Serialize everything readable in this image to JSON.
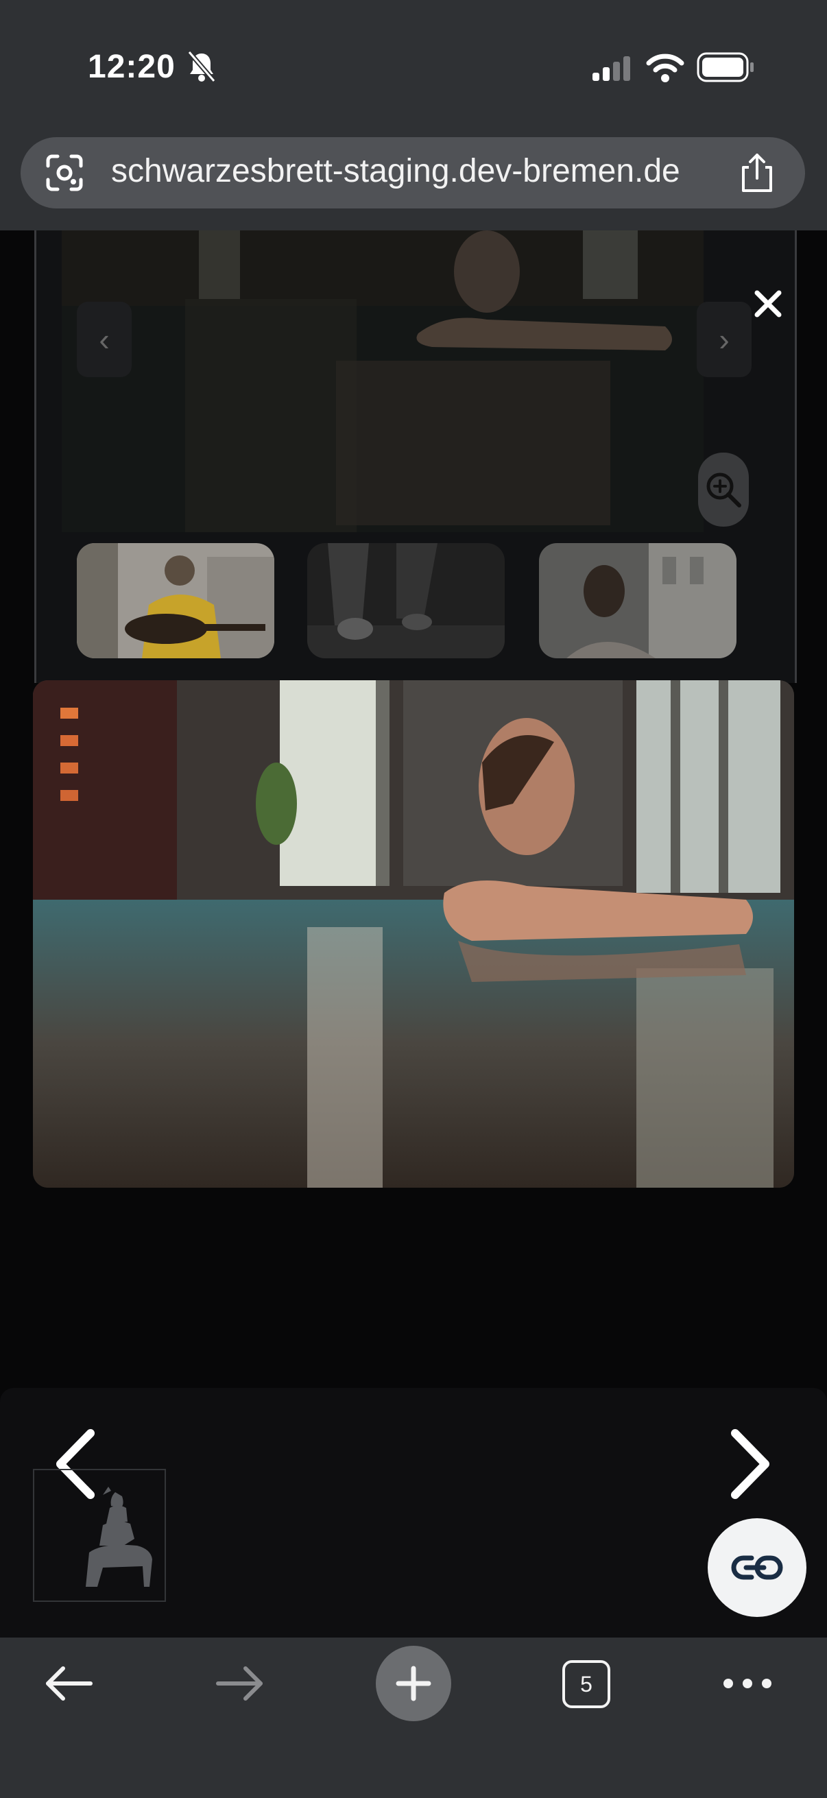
{
  "status_bar": {
    "time": "12:20",
    "icons": [
      "bell-slash-icon",
      "signal-icon",
      "wifi-icon",
      "battery-icon"
    ]
  },
  "browser": {
    "url": "schwarzesbrett-staging.dev-bremen.de",
    "tab_count": "5"
  },
  "lightbox": {
    "close_icon": "close-icon",
    "prev_icon": "chevron-left-icon",
    "next_icon": "chevron-right-icon",
    "zoom_icon": "zoom-in-icon"
  },
  "thumbnails": [
    "guitar-player-photo",
    "running-shoes-photo",
    "woman-smiling-photo"
  ],
  "colors": {
    "chrome_bg": "#2f3134",
    "url_bar_bg": "#505256",
    "page_bg": "#070708",
    "fab_bg": "#f2f3f4"
  }
}
